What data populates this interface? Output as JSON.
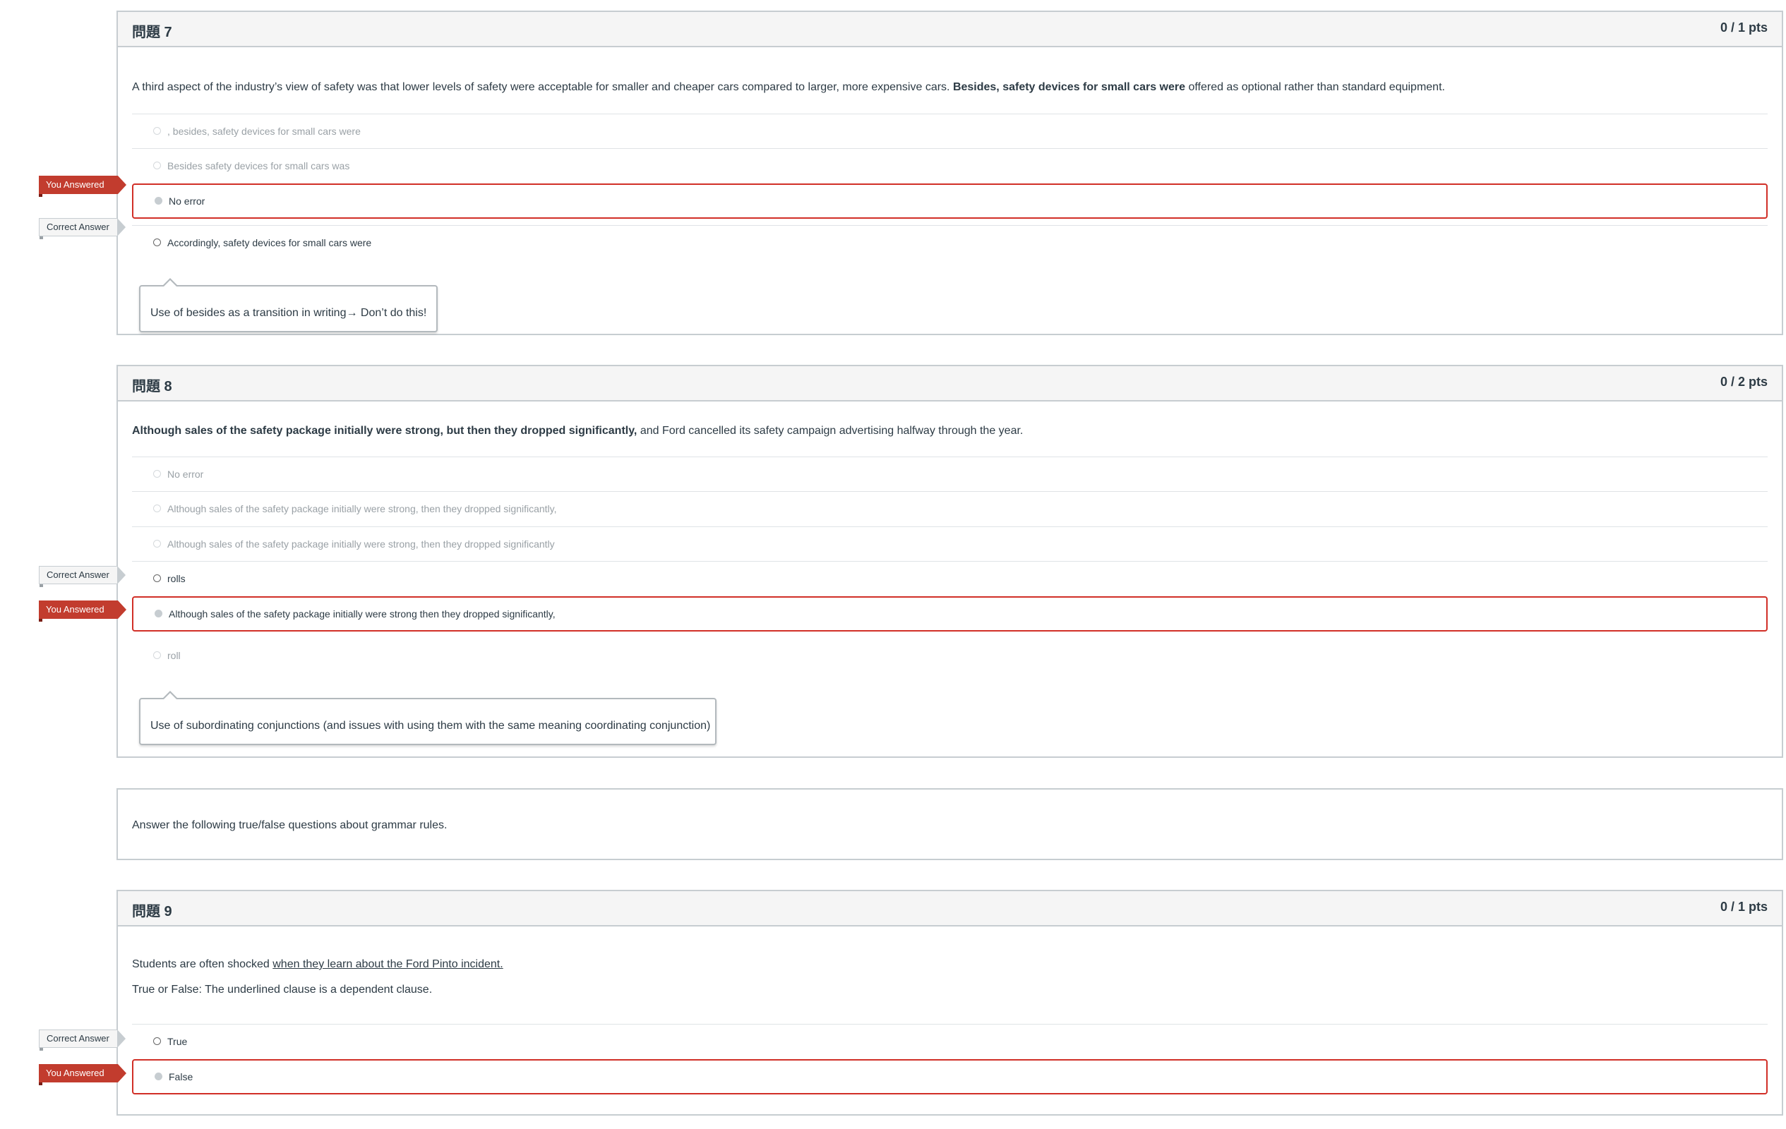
{
  "labels": {
    "you_answered": "You Answered",
    "correct_answer": "Correct Answer"
  },
  "q7": {
    "title": "問題 7",
    "points": "0 / 1 pts",
    "prompt_before": "A third aspect of the industry’s view of safety was that lower levels of safety were acceptable for smaller and cheaper cars compared to larger, more expensive cars. ",
    "prompt_bold": "Besides, safety devices for small cars were",
    "prompt_after": " offered as optional rather than standard equipment.",
    "answers": [
      ", besides, safety devices for small cars were",
      "Besides safety devices for small cars was",
      "No error",
      "Accordingly, safety devices for small cars were"
    ],
    "comment": "Use of besides as a transition in writing→ Don’t do this!"
  },
  "q8": {
    "title": "問題 8",
    "points": "0 / 2 pts",
    "prompt_bold": "Although sales of the safety package initially were strong, but then they dropped significantly,",
    "prompt_after": " and Ford cancelled its safety campaign advertising halfway through the year.",
    "answers": [
      "No error",
      "Although sales of the safety package initially were strong, then they dropped significantly,",
      "Although sales of the safety package initially were strong, then they dropped significantly",
      "rolls",
      "Although sales of the safety package initially were strong then they dropped significantly,",
      "roll"
    ],
    "comment": "Use of subordinating conjunctions (and issues with using them with the same meaning coordinating conjunction)"
  },
  "instruction": {
    "text": "Answer the following true/false questions about grammar rules."
  },
  "q9": {
    "title": "問題 9",
    "points": "0 / 1 pts",
    "prompt_before": "Students are often shocked ",
    "prompt_underlined": "when they learn about the Ford Pinto incident.",
    "prompt_line2": "True or False: The underlined clause is a dependent clause.",
    "answers": [
      "True",
      "False"
    ]
  },
  "colors": {
    "you_answered_red": "#c23c2e",
    "selected_border": "#d12f27",
    "header_bg": "#f5f5f5",
    "border": "#c7cdd1",
    "text": "#2d3b45"
  }
}
